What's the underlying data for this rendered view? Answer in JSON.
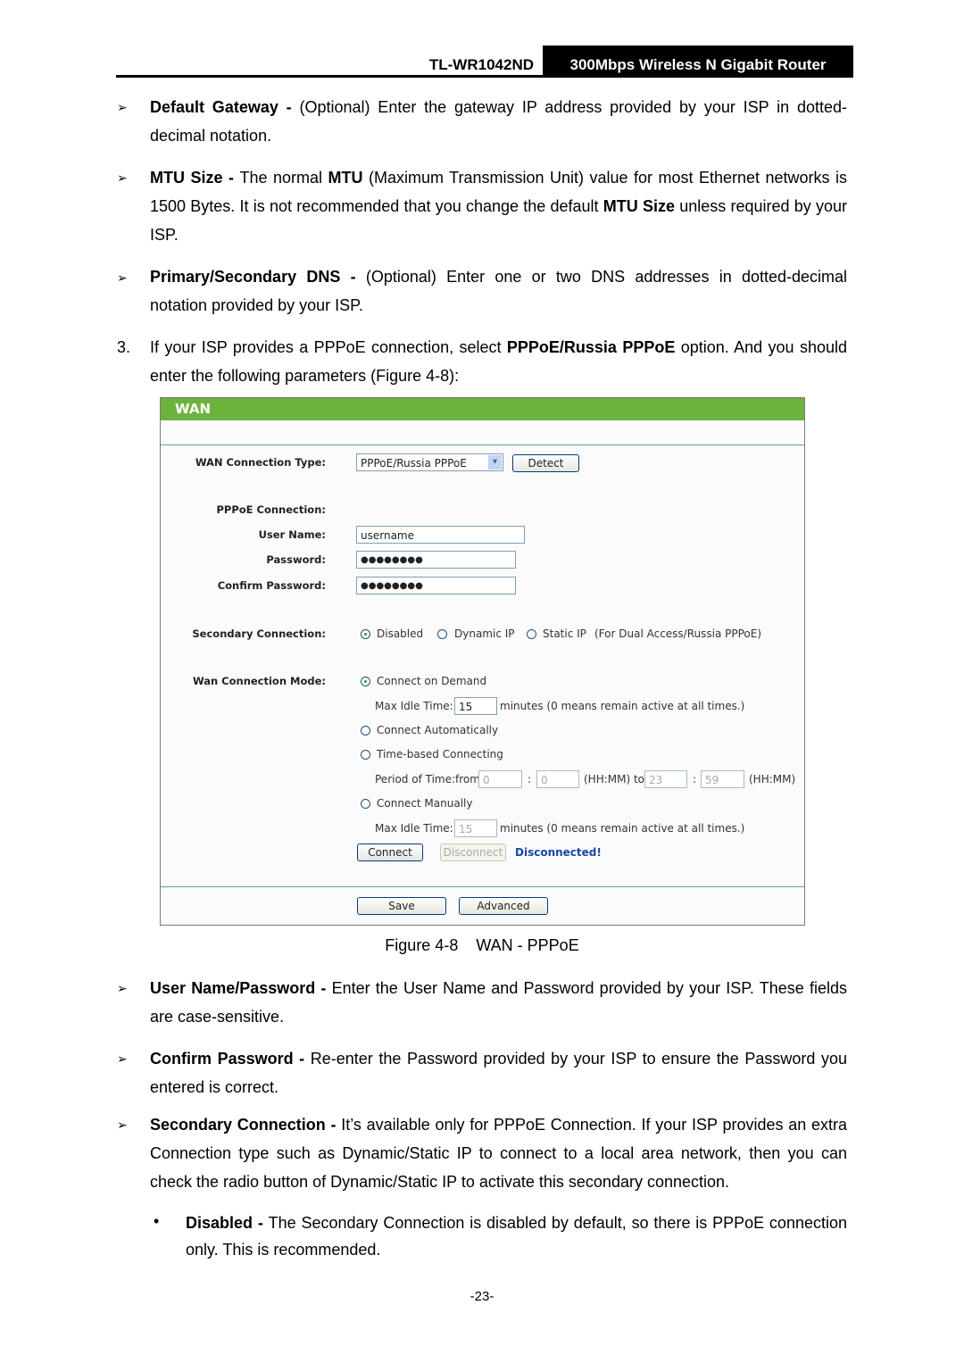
{
  "header": {
    "model": "TL-WR1042ND",
    "product": "300Mbps Wireless N Gigabit Router"
  },
  "intro": [
    {
      "term": "Default Gateway - ",
      "text": "(Optional) Enter the gateway IP address provided by your ISP in dotted-decimal notation."
    },
    {
      "term": "MTU Size - ",
      "text_a": "The normal ",
      "bold_a": "MTU",
      "text_b": " (Maximum Transmission Unit) value for most Ethernet networks is 1500 Bytes. It is not recommended that you change the default ",
      "bold_b": "MTU Size",
      "text_c": " unless required by your ISP."
    },
    {
      "term": "Primary/Secondary DNS - ",
      "text": "(Optional) Enter one or two DNS addresses in dotted-decimal notation provided by your ISP."
    }
  ],
  "step3": {
    "num": "3.",
    "text_a": "If your ISP provides a PPPoE connection, select ",
    "bold": "PPPoE/Russia PPPoE",
    "text_b": " option. And you should enter the following parameters (Figure 4-8):"
  },
  "figure": {
    "title": "WAN",
    "wan_type_label": "WAN Connection Type:",
    "wan_type_value": "PPPoE/Russia PPPoE",
    "detect": "Detect",
    "pppoe_label": "PPPoE Connection:",
    "user_label": "User Name:",
    "user_value": "username",
    "pass_label": "Password:",
    "pass_value": "●●●●●●●●",
    "confirm_label": "Confirm Password:",
    "confirm_value": "●●●●●●●●",
    "secondary_label": "Secondary Connection:",
    "secondary_options": [
      "Disabled",
      "Dynamic IP",
      "Static IP"
    ],
    "secondary_note": "(For Dual Access/Russia PPPoE)",
    "mode_label": "Wan Connection Mode:",
    "mode_demand": "Connect on Demand",
    "max_idle_label": "Max Idle Time:",
    "max_idle_value": "15",
    "minutes_note": "minutes (0 means remain active at all times.)",
    "mode_auto": "Connect Automatically",
    "mode_time": "Time-based Connecting",
    "period_label": "Period of Time:from",
    "from_hh": "0",
    "from_mm": "0",
    "hhmm_to": "(HH:MM) to",
    "to_hh": "23",
    "to_mm": "59",
    "hhmm": "(HH:MM)",
    "colon": ":",
    "mode_manual": "Connect Manually",
    "manual_idle_value": "15",
    "connect": "Connect",
    "disconnect": "Disconnect",
    "status": "Disconnected!",
    "save": "Save",
    "advanced": "Advanced"
  },
  "caption": "Figure 4-8    WAN - PPPoE",
  "after": [
    {
      "term": "User Name/Password - ",
      "text": "Enter the User Name and Password provided by your ISP. These fields are case-sensitive."
    },
    {
      "term": "Confirm Password - ",
      "text": "Re-enter the Password provided by your ISP to ensure the Password you entered is correct."
    },
    {
      "term": "Secondary Connection - ",
      "text": "It’s available only for PPPoE Connection. If your ISP provides an extra Connection type such as Dynamic/Static IP to connect to a local area network, then you can check the radio button of Dynamic/Static IP to activate this secondary connection."
    }
  ],
  "sub": {
    "term": "Disabled - ",
    "text": "The Secondary Connection is disabled by default, so there is PPPoE connection only. This is recommended."
  },
  "page": "-23-"
}
